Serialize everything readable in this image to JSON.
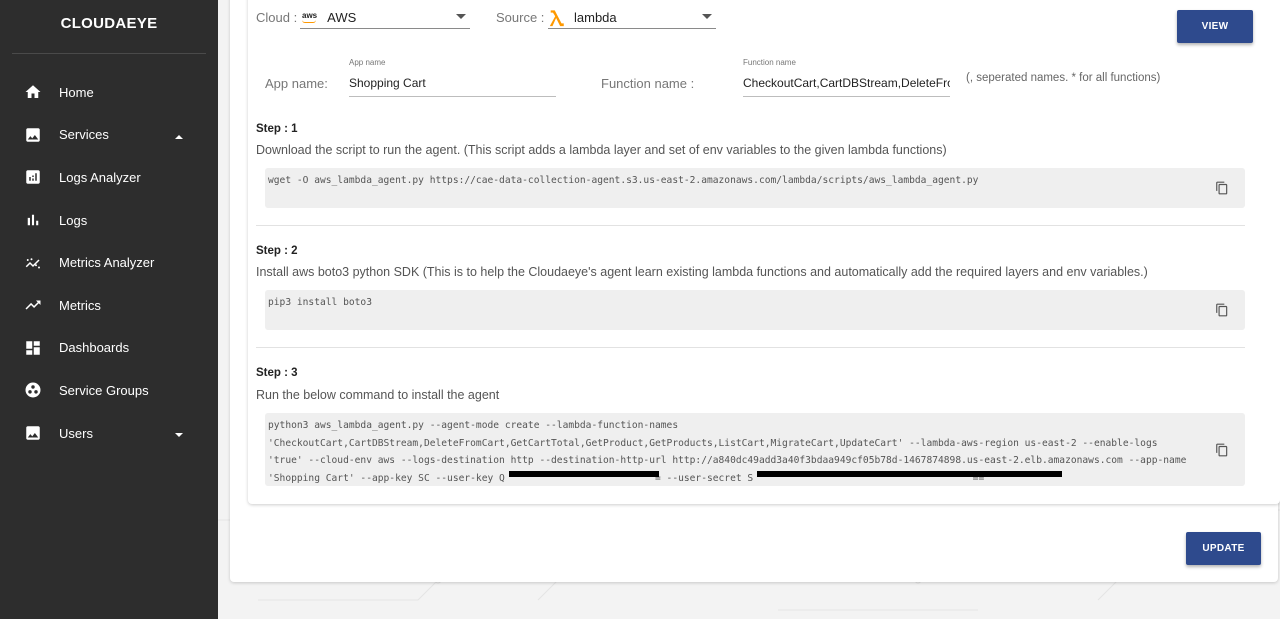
{
  "sidebar": {
    "brand": "CLOUDAEYE",
    "items": [
      {
        "label": "Home",
        "icon": "home-icon"
      },
      {
        "label": "Services",
        "icon": "image-icon",
        "expanded": true
      },
      {
        "label": "Logs Analyzer",
        "icon": "analytics-icon"
      },
      {
        "label": "Logs",
        "icon": "bar-chart-icon"
      },
      {
        "label": "Metrics Analyzer",
        "icon": "scatter-trend-icon"
      },
      {
        "label": "Metrics",
        "icon": "trending-up-icon"
      },
      {
        "label": "Dashboards",
        "icon": "dashboard-icon"
      },
      {
        "label": "Service Groups",
        "icon": "group-work-icon"
      },
      {
        "label": "Users",
        "icon": "image-icon",
        "expanded": false
      }
    ]
  },
  "form": {
    "cloud_label": "Cloud :",
    "cloud_logo": "aws",
    "cloud_value": "AWS",
    "source_label": "Source :",
    "source_value": "lambda",
    "view_button": "VIEW",
    "app_name_label": "App name:",
    "app_name_small": "App name",
    "app_name_value": "Shopping Cart",
    "function_name_label": "Function name :",
    "function_name_small": "Function name",
    "function_name_value": "CheckoutCart,CartDBStream,DeleteFromCart,GetCartTotal,GetProduct,GetProducts,ListCart,MigrateCart,UpdateCart",
    "function_hint": "(, seperated names. * for all functions)"
  },
  "steps": [
    {
      "title": "Step : 1",
      "description": "Download the script to run the agent. (This script adds a lambda layer and set of env variables to the given lambda functions)",
      "code": "wget -O aws_lambda_agent.py https://cae-data-collection-agent.s3.us-east-2.amazonaws.com/lambda/scripts/aws_lambda_agent.py"
    },
    {
      "title": "Step : 2",
      "description": "Install aws boto3 python SDK (This is to help the Cloudaeye's agent learn existing lambda functions and automatically add the required layers and env variables.)",
      "code": "pip3 install boto3"
    },
    {
      "title": "Step : 3",
      "description": "Run the below command to install the agent",
      "code": "python3 aws_lambda_agent.py --agent-mode create --lambda-function-names\n'CheckoutCart,CartDBStream,DeleteFromCart,GetCartTotal,GetProduct,GetProducts,ListCart,MigrateCart,UpdateCart' --lambda-aws-region us-east-2 --enable-logs\n'true' --cloud-env aws --logs-destination http --destination-http-url http://a840dc49add3a40f3bdaa949cf05b78d-1467874898.us-east-2.elb.amazonaws.com --app-name\n'Shopping Cart' --app-key SC --user-key Q                          = --user-secret S                                      =="
    }
  ],
  "update_button": "UPDATE",
  "colors": {
    "sidebar_bg": "#2d2d2d",
    "primary_button": "#2e4a8d",
    "lambda_orange": "#ff9900"
  }
}
